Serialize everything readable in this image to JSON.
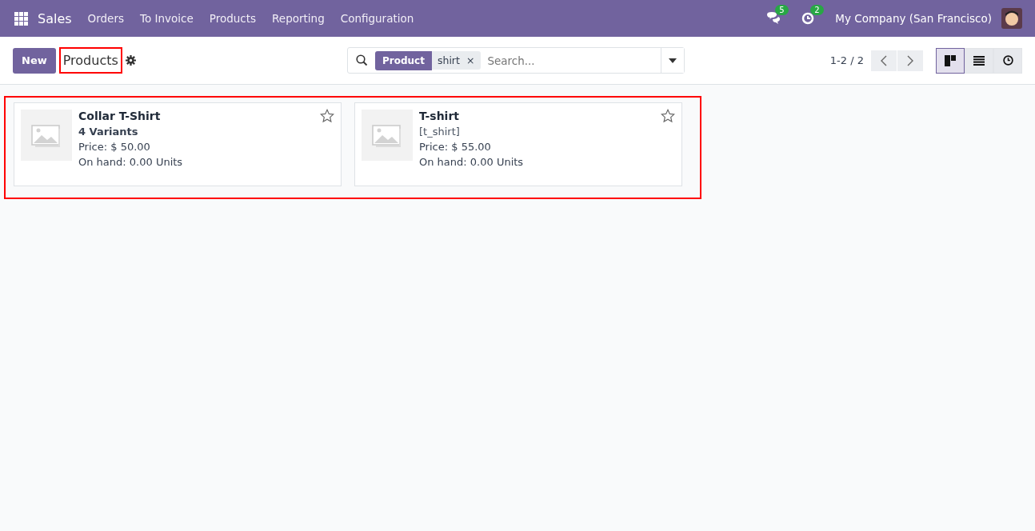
{
  "navbar": {
    "app_name": "Sales",
    "menu": [
      "Orders",
      "To Invoice",
      "Products",
      "Reporting",
      "Configuration"
    ],
    "messages_count": "5",
    "activities_count": "2",
    "company": "My Company (San Francisco)"
  },
  "control_panel": {
    "new_button": "New",
    "title": "Products",
    "title_highlighted": true,
    "search": {
      "facet_label": "Product",
      "facet_value": "shirt",
      "facet_remove": "×",
      "placeholder": "Search..."
    },
    "pager": "1-2 / 2",
    "views": [
      {
        "kind": "kanban",
        "selected": true
      },
      {
        "kind": "list",
        "selected": false
      },
      {
        "kind": "activity",
        "selected": false
      }
    ]
  },
  "kanban": {
    "highlighted": true,
    "cards": [
      {
        "kind": "variants",
        "name": "Collar T-Shirt",
        "detail": "4 Variants",
        "price": "Price: $ 50.00",
        "on_hand": "On hand: 0.00 Units",
        "favorite": false
      },
      {
        "kind": "reference",
        "name": "T-shirt",
        "detail": "[t_shirt]",
        "price": "Price: $ 55.00",
        "on_hand": "On hand: 0.00 Units",
        "favorite": false
      }
    ]
  }
}
